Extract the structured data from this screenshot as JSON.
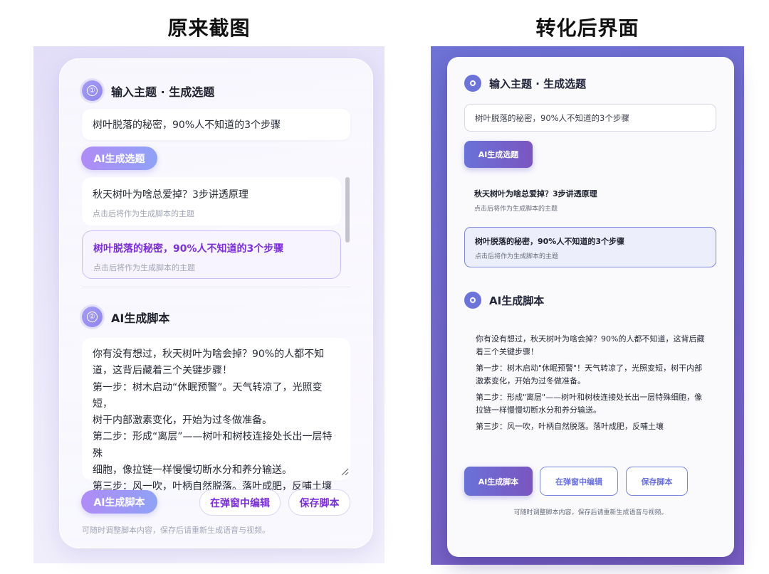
{
  "headings": {
    "left": "原来截图",
    "right": "转化后界面"
  },
  "original": {
    "step1": {
      "number": "①",
      "title": "输入主题 · 生成选题"
    },
    "topic_input_value": "树叶脱落的秘密，90%人不知道的3个步骤",
    "generate_topics_label": "AI生成选题",
    "options": [
      {
        "title": "秋天树叶为啥总爱掉？3步讲透原理",
        "subtitle": "点击后将作为生成脚本的主题"
      },
      {
        "title": "树叶脱落的秘密，90%人不知道的3个步骤",
        "subtitle": "点击后将作为生成脚本的主题"
      }
    ],
    "step2": {
      "number": "②",
      "title": "AI生成脚本"
    },
    "script_lines": [
      "你有没有想过，秋天树叶为啥会掉？90%的人都不知",
      "道，这背后藏着三个关键步骤！",
      "第一步：树木启动“休眠预警”。天气转凉了，光照变短，",
      "树干内部激素变化，开始为过冬做准备。",
      "第二步：形成“离层”——树叶和树枝连接处长出一层特殊",
      "细胞，像拉链一样慢慢切断水分和养分输送。",
      "第三步：风一吹，叶柄自然脱落。落叶成肥，反哺土壤"
    ],
    "generate_script_label": "AI生成脚本",
    "edit_popup_label": "在弹窗中编辑",
    "save_script_label": "保存脚本",
    "hint": "可随时调整脚本内容，保存后请重新生成语音与视频。"
  },
  "converted": {
    "step1_title": "输入主题 · 生成选题",
    "topic_input_value": "树叶脱落的秘密，90%人不知道的3个步骤",
    "generate_topics_label": "AI生成选题",
    "options": [
      {
        "title": "秋天树叶为啥总爱掉？3步讲透原理",
        "subtitle": "点击后将作为生成脚本的主题"
      },
      {
        "title": "树叶脱落的秘密，90%人不知道的3个步骤",
        "subtitle": "点击后将作为生成脚本的主题"
      }
    ],
    "step2_title": "AI生成脚本",
    "script_paragraphs": [
      "你有没有想过，秋天树叶为啥会掉？90%的人都不知道，这背后藏着三个关键步骤！",
      "第一步：树木启动\"休眠预警\"！天气转凉了，光照变短，树干内部激素变化，开始为过冬做准备。",
      "第二步：形成\"离层\"——树叶和树枝连接处长出一层特殊细胞，像拉链一样慢慢切断水分和养分输送。",
      "第三步：风一吹，叶柄自然脱落。落叶成肥，反哺土壤"
    ],
    "generate_script_label": "AI生成脚本",
    "edit_popup_label": "在弹窗中编辑",
    "save_script_label": "保存脚本",
    "hint": "可随时调整脚本内容，保存后请重新生成语音与视频。"
  },
  "colors": {
    "left_accent": "#7a30d6",
    "left_pill_start": "#b08cf6",
    "left_pill_end": "#8fa2f6",
    "right_bg": "#7468cc",
    "right_accent": "#6a72d8"
  }
}
